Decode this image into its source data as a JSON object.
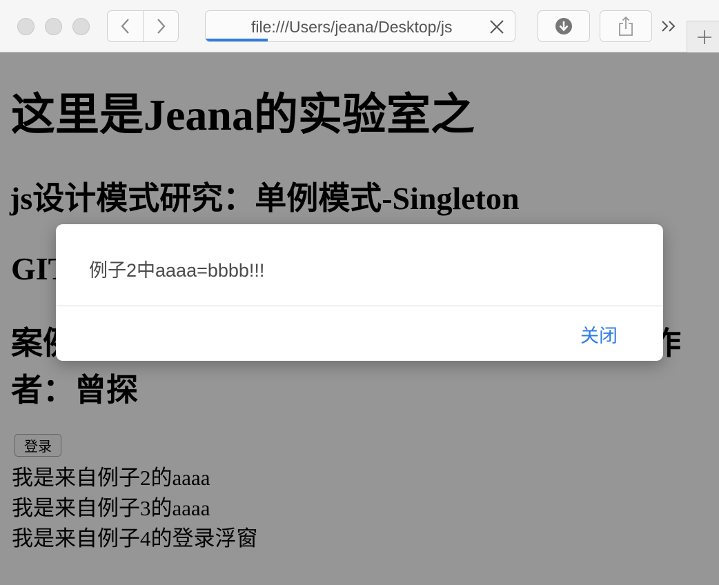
{
  "browser": {
    "url": "file:///Users/jeana/Desktop/js",
    "load_progress_fraction": 0.2,
    "accent_color": "#2f7ce5",
    "icons": {
      "back": "chevron-left-icon",
      "forward": "chevron-right-icon",
      "stop": "close-x-icon",
      "downloads": "download-arrow-icon",
      "share": "share-icon",
      "overflow": "double-chevron-right-icon",
      "new_tab": "plus-icon"
    }
  },
  "page": {
    "title": "这里是Jeana的实验室之",
    "pattern_heading": "js设计模式研究：单例模式-Singleton",
    "git_heading": "GIT",
    "case_heading": "案例来源：《JavaScript设计模式与开发实践》作者：曾探",
    "login_button": "登录",
    "output_lines": [
      "我是来自例子2的aaaa",
      "我是来自例子3的aaaa",
      "我是来自例子4的登录浮窗"
    ]
  },
  "alert": {
    "message": "例子2中aaaa=bbbb!!!",
    "close_label": "关闭",
    "overlay_color": "#000000"
  }
}
